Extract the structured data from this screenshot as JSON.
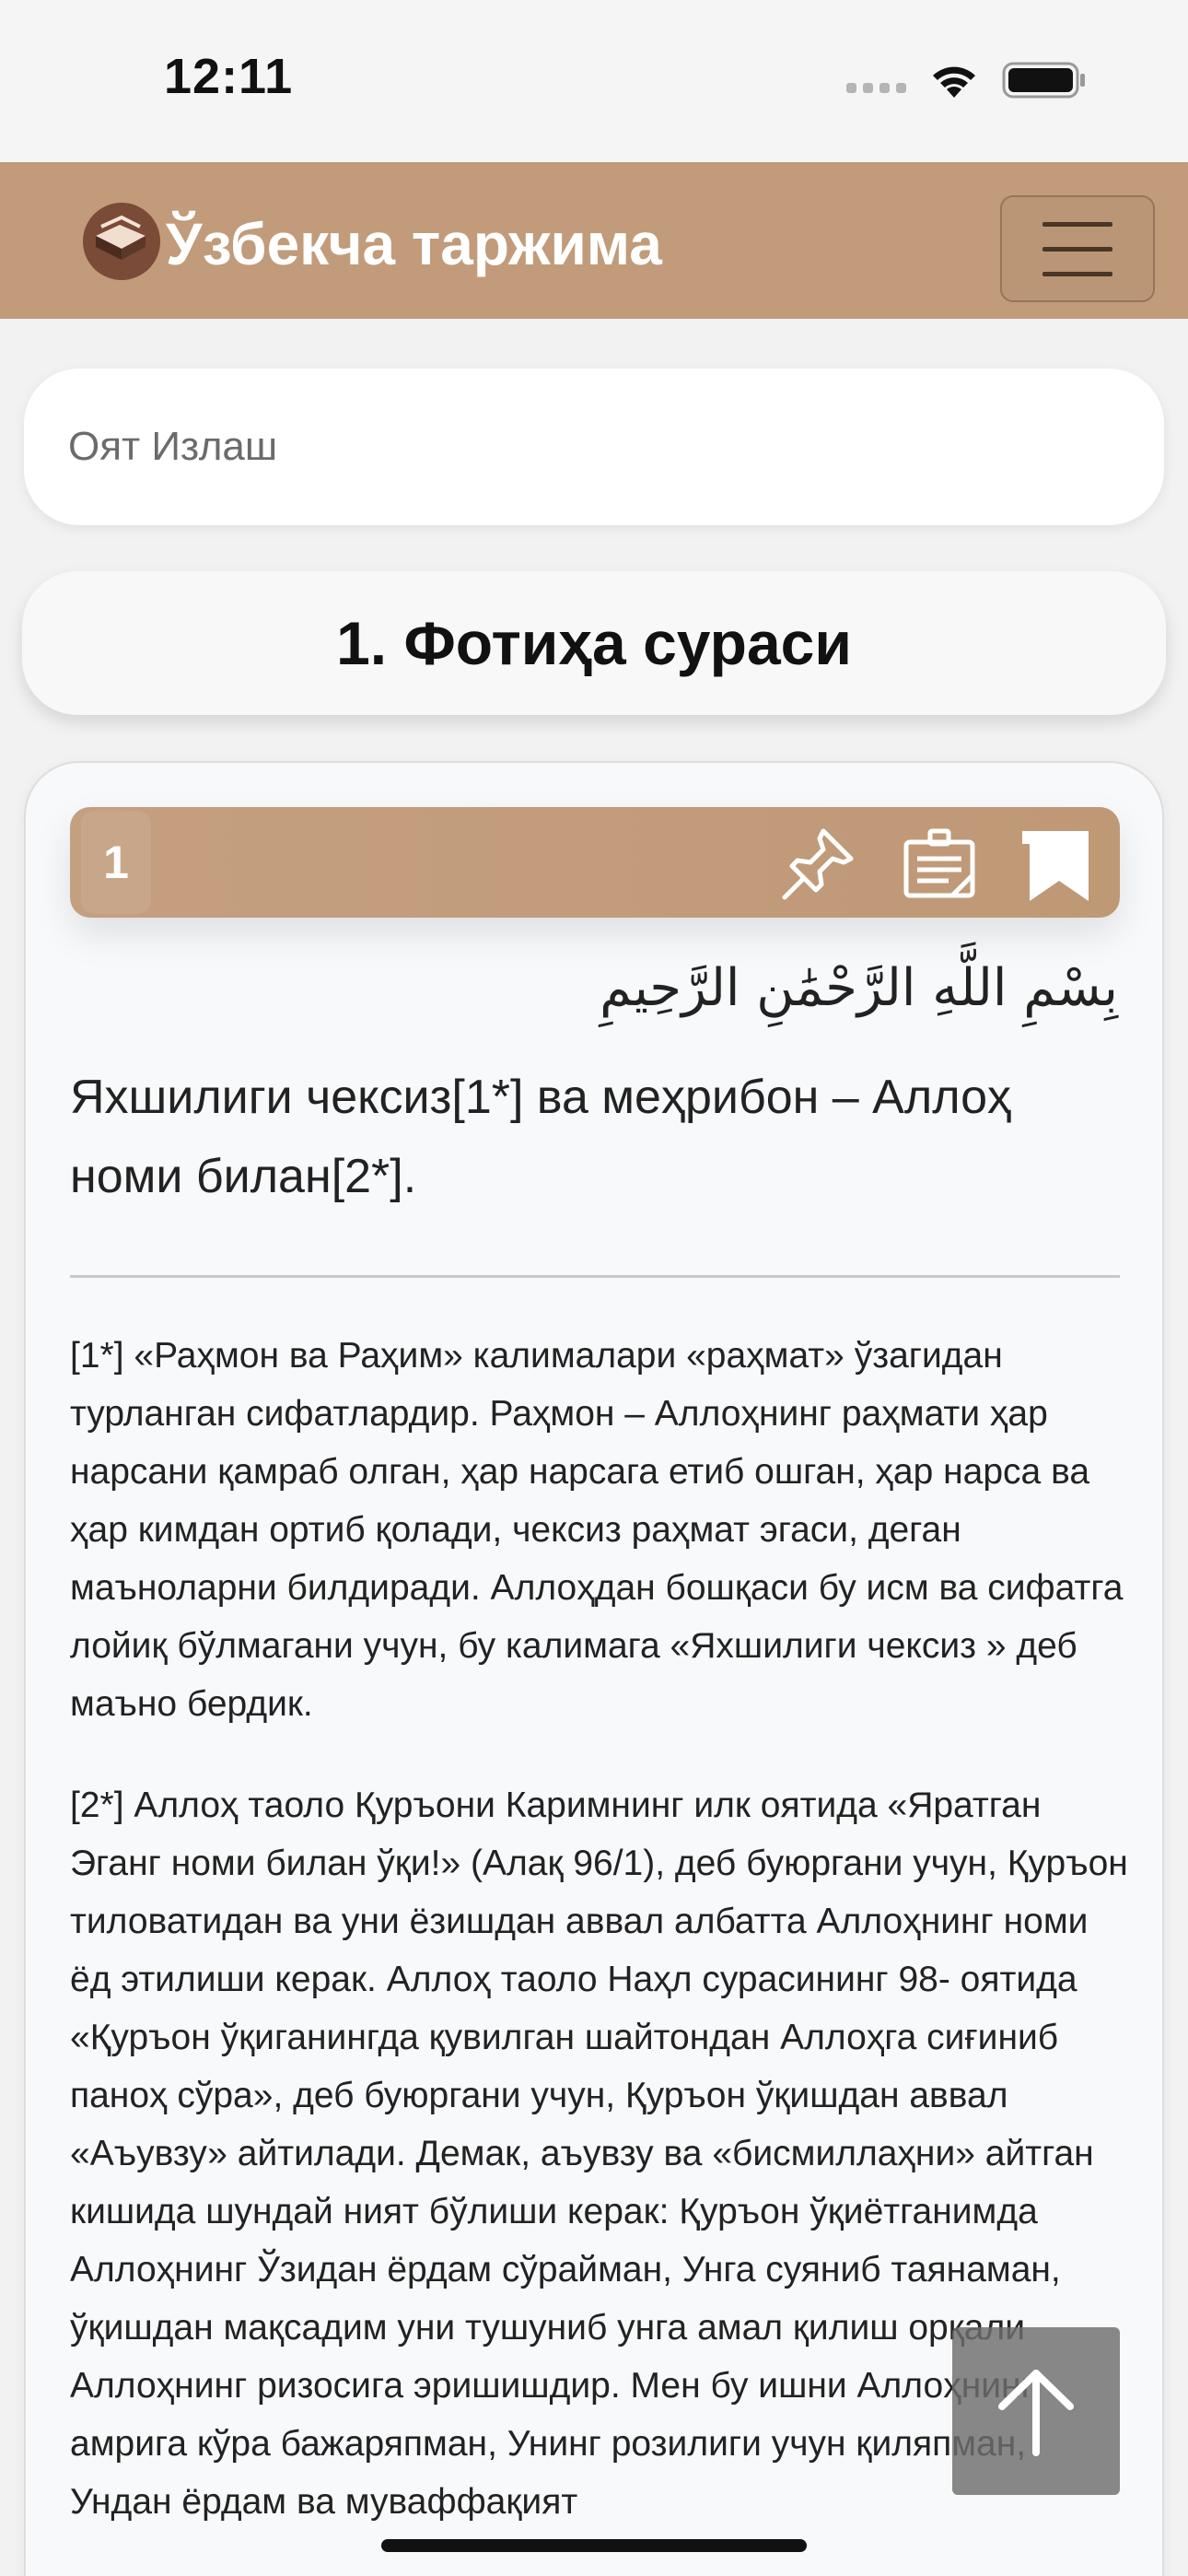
{
  "status_bar": {
    "time": "12:11",
    "icons": [
      "signal-dots-icon",
      "wifi-icon",
      "battery-icon"
    ]
  },
  "header": {
    "title": "Ўзбекча таржима",
    "logo_icon": "book-logo-icon",
    "menu_icon": "hamburger-menu-icon",
    "background": "#c19b7a"
  },
  "search": {
    "placeholder": "Оят Излаш",
    "value": ""
  },
  "surah": {
    "title": "1. Фотиҳа сураси"
  },
  "ayah": {
    "number": "1",
    "actions": [
      "pin-icon",
      "note-icon",
      "bookmark-icon"
    ],
    "arabic": "بِسْمِ اللَّهِ الرَّحْمَٰنِ الرَّحِيمِ",
    "translation": "Яхшилиги чексиз[1*] ва меҳрибон – Аллоҳ номи билан[2*].",
    "footnotes": [
      "[1*] «Раҳмон ва Раҳим» калималари «раҳмат» ўзагидан турланган сифатлардир. Раҳмон – Аллоҳнинг раҳмати ҳар нарсани қамраб олган, ҳар нарсага етиб ошган, ҳар нарса ва ҳар кимдан ортиб қолади, чексиз раҳмат эгаси, деган маъноларни билдиради. Аллоҳдан бошқаси бу исм ва сифатга лойиқ бўлмагани учун, бу калимага «Яхшилиги чексиз » деб маъно бердик.",
      "[2*] Аллоҳ таоло Қуръони Каримнинг илк оятида «Яратган Эганг номи билан ўқи!» (Алақ 96/1), деб буюргани учун, Қуръон тиловатидан ва уни ёзишдан аввал албатта Аллоҳнинг номи ёд этилиши керак. Аллоҳ таоло Наҳл сурасининг 98- оятида «Қуръон ўқиганингда қувилган шайтондан Аллоҳга сиғиниб паноҳ сўра», деб буюргани учун, Қуръон ўқишдан аввал «Аъувзу» айтилади. Демак, аъувзу ва «бисмиллаҳни» айтган кишида шундай ният бўлиши керак: Қуръон ўқиётганимда Аллоҳнинг Ўзидан ёрдам сўрайман, Унга суяниб таянаман, ўқишдан мақсадим уни тушуниб унга амал қилиш орқали Аллоҳнинг ризосига эришишдир. Мен бу ишни Аллоҳнинг амрига кўра бажаряпман, Унинг розилиги учун қиляпман, Ундан ёрдам ва муваффақият"
    ]
  },
  "scroll_top": {
    "icon": "arrow-up-icon"
  }
}
